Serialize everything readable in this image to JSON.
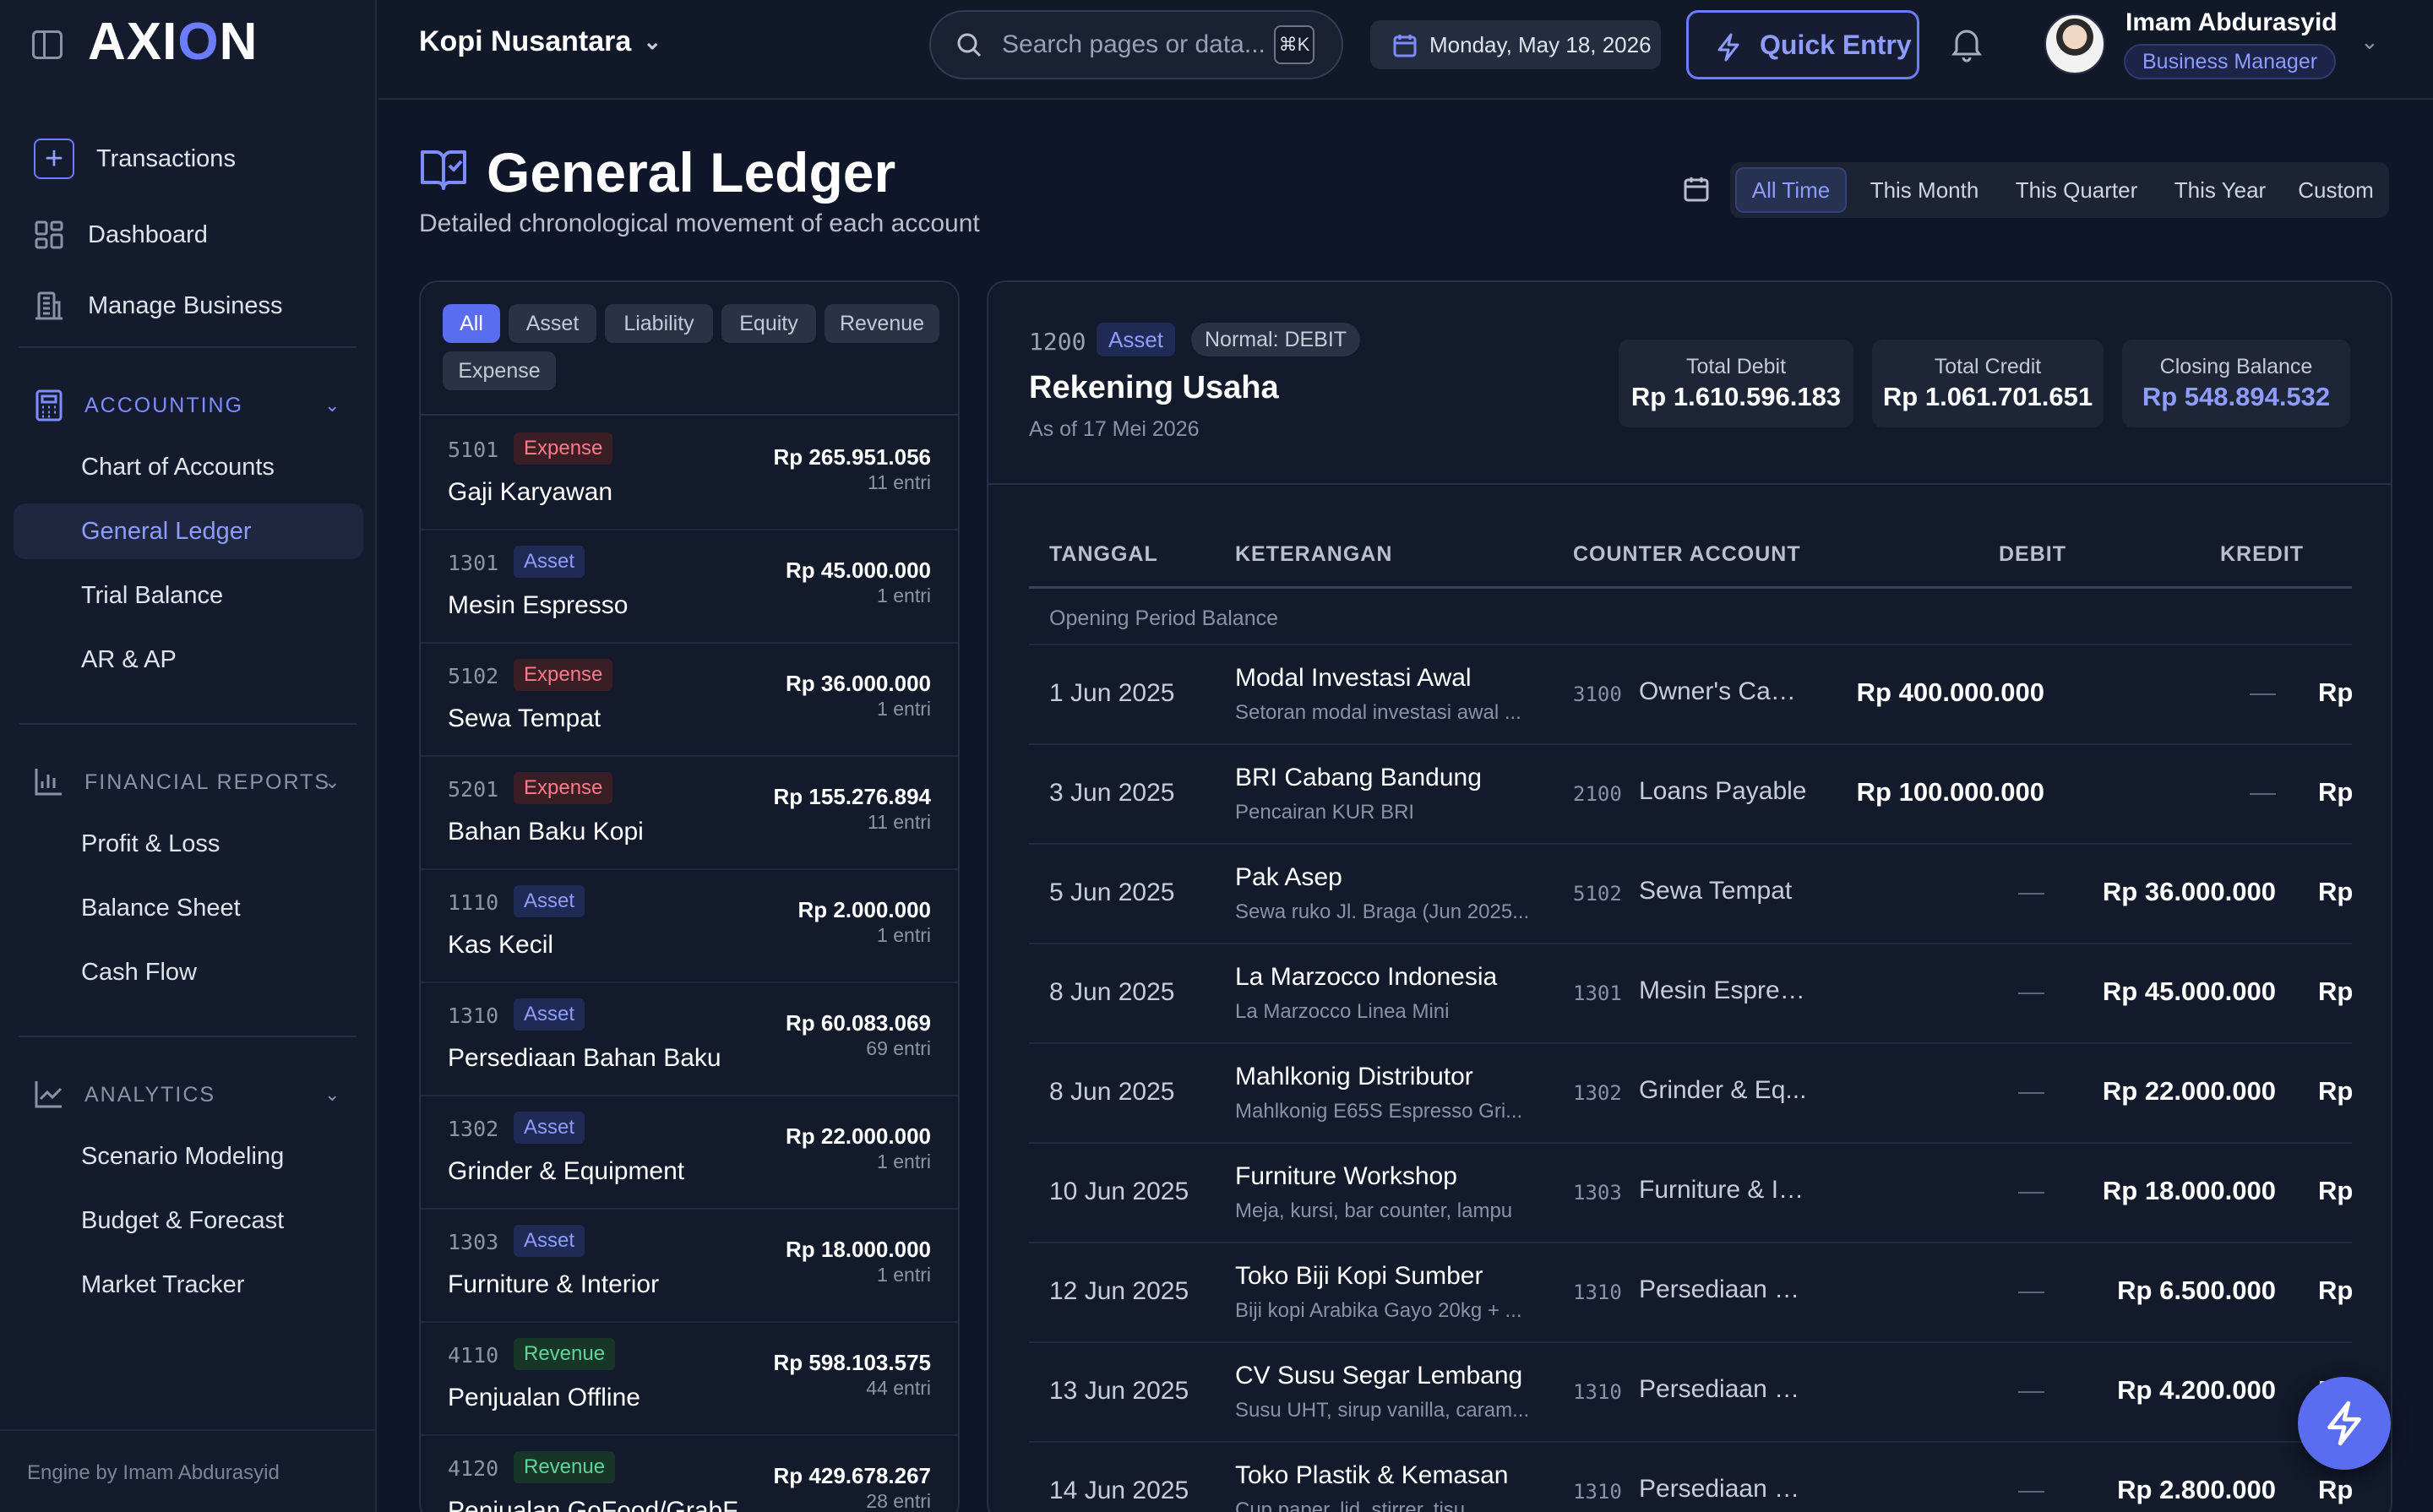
{
  "app": {
    "logo": "AXION"
  },
  "sidebar": {
    "top_items": [
      {
        "label": "Transactions",
        "icon": "plus-icon"
      },
      {
        "label": "Dashboard",
        "icon": "grid-icon"
      },
      {
        "label": "Manage Business",
        "icon": "building-icon"
      }
    ],
    "sections": [
      {
        "title": "ACCOUNTING",
        "icon": "calculator-icon",
        "items": [
          "Chart of Accounts",
          "General Ledger",
          "Trial Balance",
          "AR & AP"
        ]
      },
      {
        "title": "FINANCIAL REPORTS",
        "icon": "bar-chart-icon",
        "items": [
          "Profit & Loss",
          "Balance Sheet",
          "Cash Flow"
        ]
      },
      {
        "title": "ANALYTICS",
        "icon": "line-chart-icon",
        "items": [
          "Scenario Modeling",
          "Budget & Forecast",
          "Market Tracker"
        ]
      }
    ],
    "active_item": "General Ledger",
    "footer": "Engine by Imam Abdurasyid"
  },
  "header": {
    "company": "Kopi Nusantara",
    "search_placeholder": "Search pages or data...",
    "search_shortcut": "⌘K",
    "date": "Monday, May 18, 2026",
    "quick_entry": "Quick Entry",
    "user_name": "Imam Abdurasyid",
    "user_role": "Business Manager"
  },
  "page": {
    "title": "General Ledger",
    "subtitle": "Detailed chronological movement of each account",
    "periods": [
      "All Time",
      "This Month",
      "This Quarter",
      "This Year",
      "Custom"
    ],
    "active_period": "All Time"
  },
  "filters": [
    "All",
    "Asset",
    "Liability",
    "Equity",
    "Revenue",
    "Expense"
  ],
  "accounts": [
    {
      "code": "5101",
      "type": "Expense",
      "name": "Gaji Karyawan",
      "amount": "Rp 265.951.056",
      "entries": "11 entri"
    },
    {
      "code": "1301",
      "type": "Asset",
      "name": "Mesin Espresso",
      "amount": "Rp 45.000.000",
      "entries": "1 entri"
    },
    {
      "code": "5102",
      "type": "Expense",
      "name": "Sewa Tempat",
      "amount": "Rp 36.000.000",
      "entries": "1 entri"
    },
    {
      "code": "5201",
      "type": "Expense",
      "name": "Bahan Baku Kopi",
      "amount": "Rp 155.276.894",
      "entries": "11 entri"
    },
    {
      "code": "1110",
      "type": "Asset",
      "name": "Kas Kecil",
      "amount": "Rp 2.000.000",
      "entries": "1 entri"
    },
    {
      "code": "1310",
      "type": "Asset",
      "name": "Persediaan Bahan Baku",
      "amount": "Rp 60.083.069",
      "entries": "69 entri"
    },
    {
      "code": "1302",
      "type": "Asset",
      "name": "Grinder & Equipment",
      "amount": "Rp 22.000.000",
      "entries": "1 entri"
    },
    {
      "code": "1303",
      "type": "Asset",
      "name": "Furniture & Interior",
      "amount": "Rp 18.000.000",
      "entries": "1 entri"
    },
    {
      "code": "4110",
      "type": "Revenue",
      "name": "Penjualan Offline",
      "amount": "Rp 598.103.575",
      "entries": "44 entri"
    },
    {
      "code": "4120",
      "type": "Revenue",
      "name": "Penjualan GoFood/GrabF...",
      "amount": "Rp 429.678.267",
      "entries": "28 entri"
    }
  ],
  "detail": {
    "code": "1200",
    "type": "Asset",
    "normal": "Normal: DEBIT",
    "name": "Rekening Usaha",
    "as_of": "As of 17 Mei 2026",
    "total_debit_label": "Total Debit",
    "total_debit": "Rp 1.610.596.183",
    "total_credit_label": "Total Credit",
    "total_credit": "Rp 1.061.701.651",
    "closing_label": "Closing Balance",
    "closing": "Rp 548.894.532",
    "columns": [
      "TANGGAL",
      "KETERANGAN",
      "COUNTER ACCOUNT",
      "DEBIT",
      "KREDIT"
    ],
    "opening": "Opening Period Balance",
    "rows": [
      {
        "date": "1 Jun 2025",
        "desc": "Modal Investasi Awal",
        "sub": "Setoran modal investasi awal ...",
        "cc": "3100",
        "cn": "Owner's Capi...",
        "debit": "Rp 400.000.000",
        "credit": "—",
        "bal": "Rp"
      },
      {
        "date": "3 Jun 2025",
        "desc": "BRI Cabang Bandung",
        "sub": "Pencairan KUR BRI",
        "cc": "2100",
        "cn": "Loans Payable",
        "debit": "Rp 100.000.000",
        "credit": "—",
        "bal": "Rp"
      },
      {
        "date": "5 Jun 2025",
        "desc": "Pak Asep",
        "sub": "Sewa ruko Jl. Braga (Jun 2025...",
        "cc": "5102",
        "cn": "Sewa Tempat",
        "debit": "—",
        "credit": "Rp 36.000.000",
        "bal": "Rp"
      },
      {
        "date": "8 Jun 2025",
        "desc": "La Marzocco Indonesia",
        "sub": "La Marzocco Linea Mini",
        "cc": "1301",
        "cn": "Mesin Espres...",
        "debit": "—",
        "credit": "Rp 45.000.000",
        "bal": "Rp"
      },
      {
        "date": "8 Jun 2025",
        "desc": "Mahlkonig Distributor",
        "sub": "Mahlkonig E65S Espresso Gri...",
        "cc": "1302",
        "cn": "Grinder & Eq...",
        "debit": "—",
        "credit": "Rp 22.000.000",
        "bal": "Rp"
      },
      {
        "date": "10 Jun 2025",
        "desc": "Furniture Workshop",
        "sub": "Meja, kursi, bar counter, lampu",
        "cc": "1303",
        "cn": "Furniture & In...",
        "debit": "—",
        "credit": "Rp 18.000.000",
        "bal": "Rp"
      },
      {
        "date": "12 Jun 2025",
        "desc": "Toko Biji Kopi Sumber",
        "sub": "Biji kopi Arabika Gayo 20kg + ...",
        "cc": "1310",
        "cn": "Persediaan B...",
        "debit": "—",
        "credit": "Rp 6.500.000",
        "bal": "Rp"
      },
      {
        "date": "13 Jun 2025",
        "desc": "CV Susu Segar Lembang",
        "sub": "Susu UHT, sirup vanilla, caram...",
        "cc": "1310",
        "cn": "Persediaan B...",
        "debit": "—",
        "credit": "Rp 4.200.000",
        "bal": "Rp"
      },
      {
        "date": "14 Jun 2025",
        "desc": "Toko Plastik & Kemasan",
        "sub": "Cup paper, lid, stirrer, tisu",
        "cc": "1310",
        "cn": "Persediaan B...",
        "debit": "—",
        "credit": "Rp 2.800.000",
        "bal": "Rp"
      }
    ]
  }
}
